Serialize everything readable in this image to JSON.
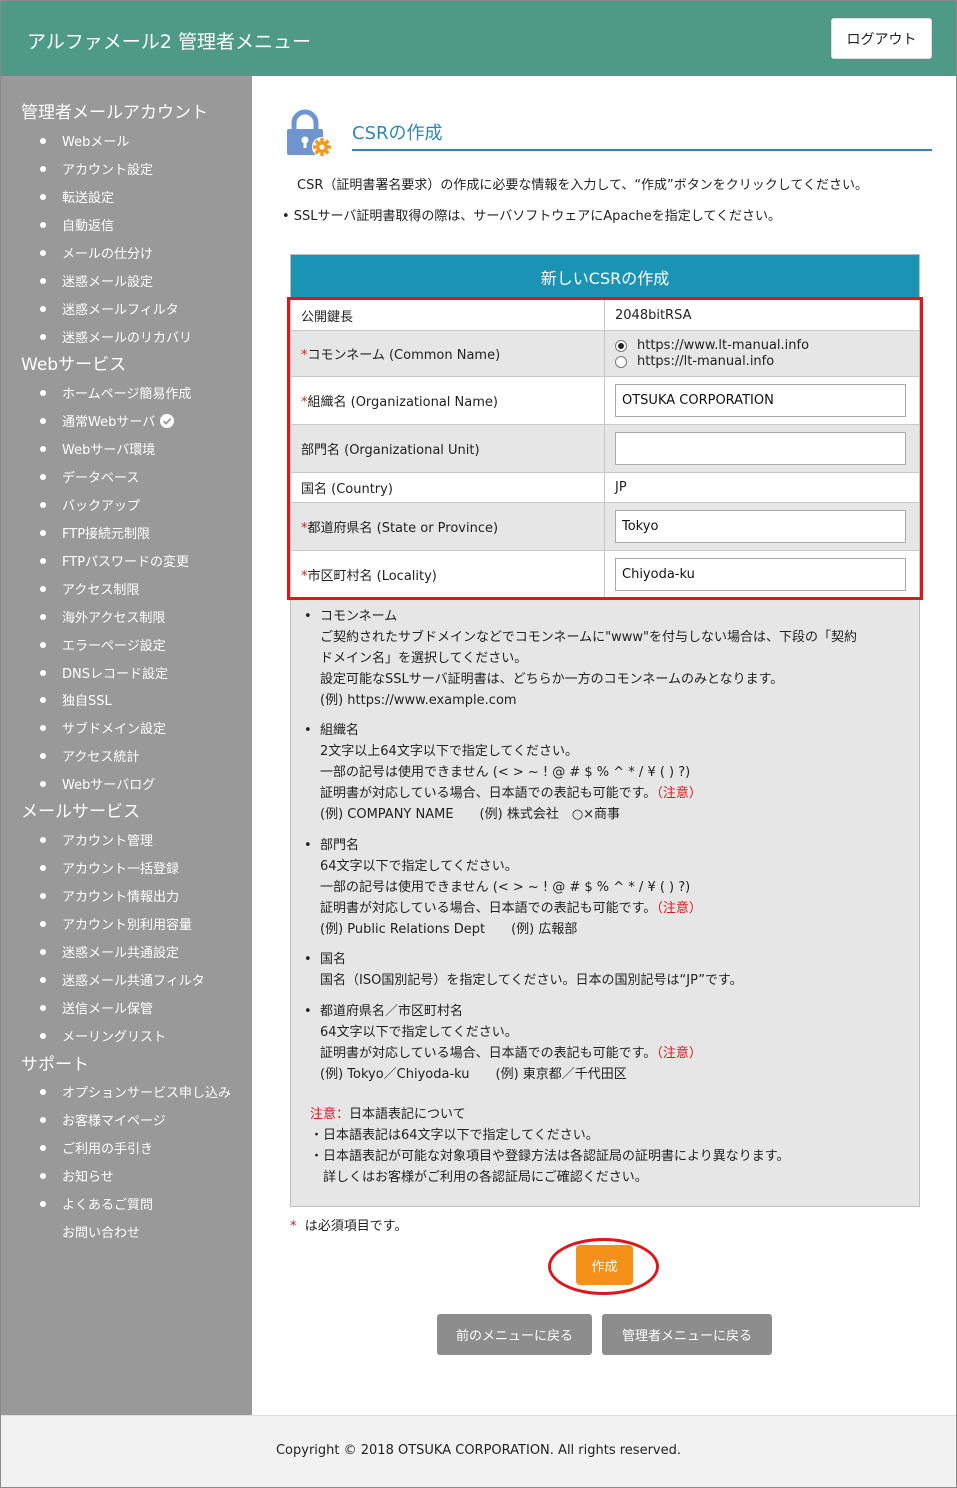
{
  "header": {
    "title": "アルファメール2 管理者メニュー",
    "logout_label": "ログアウト"
  },
  "sidebar": {
    "sections": [
      {
        "title": "管理者メールアカウント",
        "items": [
          "Webメール",
          "アカウント設定",
          "転送設定",
          "自動返信",
          "メールの仕分け",
          "迷惑メール設定",
          "迷惑メールフィルタ",
          "迷惑メールのリカバリ"
        ]
      },
      {
        "title": "Webサービス",
        "items": [
          "ホームページ簡易作成",
          "通常Webサーバ",
          "Webサーバ環境",
          "データベース",
          "バックアップ",
          "FTP接続元制限",
          "FTPパスワードの変更",
          "アクセス制限",
          "海外アクセス制限",
          "エラーページ設定",
          "DNSレコード設定",
          "独自SSL",
          "サブドメイン設定",
          "アクセス統計",
          "Webサーバログ"
        ]
      },
      {
        "title": "メールサービス",
        "items": [
          "アカウント管理",
          "アカウント一括登録",
          "アカウント情報出力",
          "アカウント別利用容量",
          "迷惑メール共通設定",
          "迷惑メール共通フィルタ",
          "送信メール保管",
          "メーリングリスト"
        ]
      },
      {
        "title": "サポート",
        "items": [
          "オプションサービス申し込み",
          "お客様マイページ",
          "ご利用の手引き",
          "お知らせ",
          "よくあるご質問",
          "お問い合わせ"
        ]
      }
    ]
  },
  "page": {
    "title": "CSRの作成",
    "intro": "CSR（証明書署名要求）の作成に必要な情報を入力して、“作成”ボタンをクリックしてください。",
    "ssl_note": "• SSLサーバ証明書取得の際は、サーバソフトウェアにApacheを指定してください。",
    "panel_title": "新しいCSRの作成"
  },
  "form": {
    "key_length_label": "公開鍵長",
    "key_length_value": "2048bitRSA",
    "cn_label": "コモンネーム (Common Name)",
    "cn_option1": "https://www.lt-manual.info",
    "cn_option2": "https://lt-manual.info",
    "org_label": "組織名 (Organizational Name)",
    "org_value": "OTSUKA CORPORATION",
    "unit_label": "部門名 (Organizational Unit)",
    "unit_value": "",
    "country_label": "国名 (Country)",
    "country_value": "JP",
    "state_label": "都道府県名 (State or Province)",
    "state_value": "Tokyo",
    "locality_label": "市区町村名 (Locality)",
    "locality_value": "Chiyoda-ku",
    "asterisk": "*"
  },
  "notes": {
    "cn_title": "コモンネーム",
    "cn_l1": "ご契約されたサブドメインなどでコモンネームに\"www\"を付与しない場合は、下段の「契約",
    "cn_l2": "ドメイン名」を選択してください。",
    "cn_l3": "設定可能なSSLサーバ証明書は、どちらか一方のコモンネームのみとなります。",
    "cn_l4": "(例) https://www.example.com",
    "org_title": "組織名",
    "org_l1": "2文字以上64文字以下で指定してください。",
    "org_l2": "一部の記号は使用できません (< > ~ ! @ # $ % ^ * / ¥ ( ) ?)",
    "org_l3": "証明書が対応している場合、日本語での表記も可能です。",
    "org_l4": "(例) COMPANY NAME　　(例) 株式会社　○×商事",
    "unit_title": "部門名",
    "unit_l1": "64文字以下で指定してください。",
    "unit_l2": "一部の記号は使用できません (< > ~ ! @ # $ % ^ * / ¥ ( ) ?)",
    "unit_l3": "証明書が対応している場合、日本語での表記も可能です。",
    "unit_l4": "(例) Public Relations Dept　　(例) 広報部",
    "country_title": "国名",
    "country_l1": "国名（ISO国別記号）を指定してください。日本の国別記号は“JP”です。",
    "loc_title": "都道府県名／市区町村名",
    "loc_l1": "64文字以下で指定してください。",
    "loc_l2": "証明書が対応している場合、日本語での表記も可能です。",
    "loc_l3": "(例) Tokyo／Chiyoda-ku　　(例) 東京都／千代田区",
    "caution_link": "（注意）",
    "caution_head": "注意：",
    "caution_title": "日本語表記について",
    "caution_l1": "・日本語表記は64文字以下で指定してください。",
    "caution_l2": "・日本語表記が可能な対象項目や登録方法は各認証局の証明書により異なります。",
    "caution_l3": "　詳しくはお客様がご利用の各認証局にご確認ください。"
  },
  "footer_area": {
    "required_note": "は必須項目です。",
    "create_label": "作成",
    "back_label": "前のメニューに戻る",
    "admin_label": "管理者メニューに戻る",
    "copyright": "Copyright © 2018 OTSUKA CORPORATION. All rights reserved."
  }
}
